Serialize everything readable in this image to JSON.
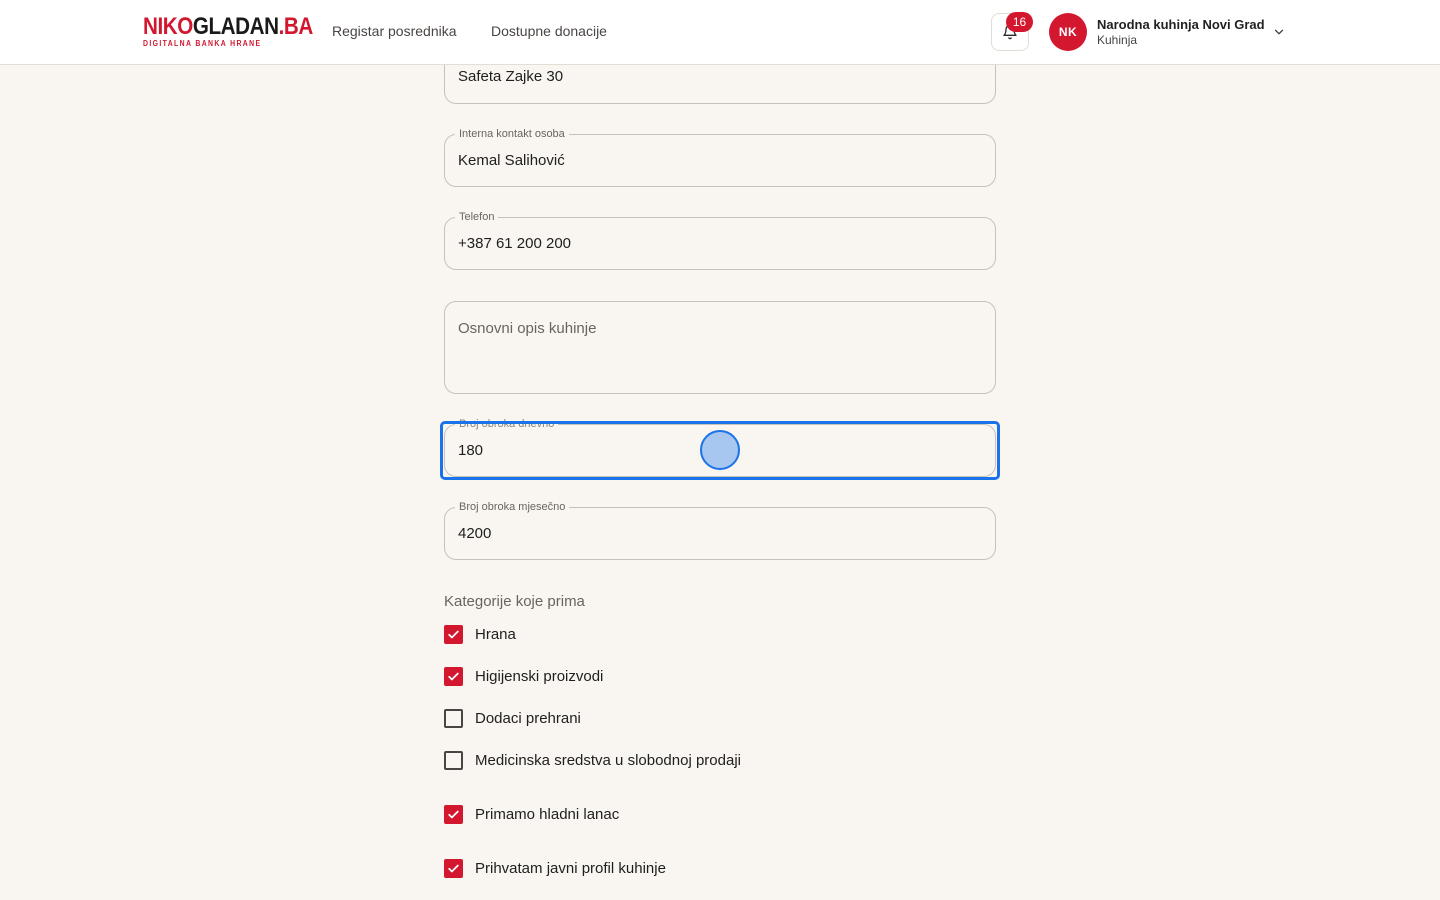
{
  "header": {
    "logo": {
      "part1": "NIKO",
      "part2": "GLADAN",
      "part3": ".BA",
      "tagline": "DIGITALNA BANKA HRANE"
    },
    "nav": [
      {
        "label": "Registar posrednika"
      },
      {
        "label": "Dostupne donacije"
      }
    ],
    "notifications": {
      "count": "16",
      "icon": "bell-icon"
    },
    "user": {
      "initials": "NK",
      "name": "Narodna kuhinja Novi Grad",
      "role": "Kuhinja",
      "menu_icon": "chevron-down-icon"
    }
  },
  "form": {
    "address": {
      "value": "Safeta Zajke 30"
    },
    "contact_person": {
      "label": "Interna kontakt osoba",
      "value": "Kemal Salihović"
    },
    "phone": {
      "label": "Telefon",
      "value": "+387 61 200 200"
    },
    "description": {
      "placeholder": "Osnovni opis kuhinje",
      "value": ""
    },
    "meals_daily": {
      "label": "Broj obroka dnevno",
      "value": "180"
    },
    "meals_monthly": {
      "label": "Broj obroka mjesečno",
      "value": "4200"
    },
    "categories_title": "Kategorije koje prima",
    "categories": [
      {
        "label": "Hrana",
        "checked": true
      },
      {
        "label": "Higijenski proizvodi",
        "checked": true
      },
      {
        "label": "Dodaci prehrani",
        "checked": false
      },
      {
        "label": "Medicinska sredstva u slobodnoj prodaji",
        "checked": false
      }
    ],
    "cold_chain": {
      "label": "Primamo hladni lanac",
      "checked": true
    },
    "public_profile": {
      "label": "Prihvatam javni profil kuhinje",
      "checked": true
    }
  },
  "colors": {
    "brand": "#d2172f",
    "focus": "#1a73e8",
    "background": "#f9f5f0"
  }
}
